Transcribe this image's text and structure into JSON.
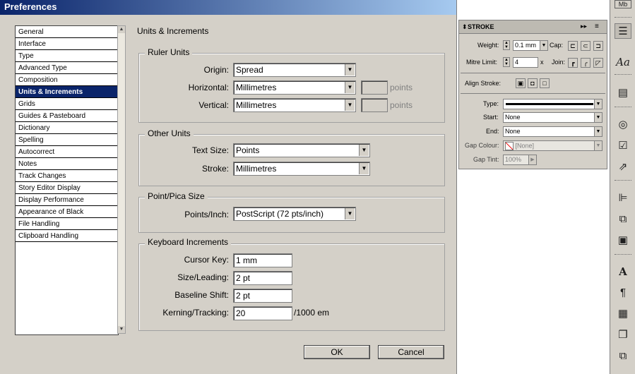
{
  "dialog": {
    "title": "Preferences",
    "categories": [
      "General",
      "Interface",
      "Type",
      "Advanced Type",
      "Composition",
      "Units & Increments",
      "Grids",
      "Guides & Pasteboard",
      "Dictionary",
      "Spelling",
      "Autocorrect",
      "Notes",
      "Track Changes",
      "Story Editor Display",
      "Display Performance",
      "Appearance of Black",
      "File Handling",
      "Clipboard Handling"
    ],
    "selected_category": "Units & Increments",
    "section_title": "Units & Increments",
    "ruler_units": {
      "title": "Ruler Units",
      "origin_label": "Origin:",
      "origin_value": "Spread",
      "horizontal_label": "Horizontal:",
      "horizontal_value": "Millimetres",
      "horizontal_points_label": "points",
      "vertical_label": "Vertical:",
      "vertical_value": "Millimetres",
      "vertical_points_label": "points"
    },
    "other_units": {
      "title": "Other Units",
      "text_size_label": "Text Size:",
      "text_size_value": "Points",
      "stroke_label": "Stroke:",
      "stroke_value": "Millimetres"
    },
    "point_pica": {
      "title": "Point/Pica Size",
      "points_inch_label": "Points/Inch:",
      "points_inch_value": "PostScript (72 pts/inch)"
    },
    "keyboard": {
      "title": "Keyboard Increments",
      "cursor_key_label": "Cursor Key:",
      "cursor_key_value": "1 mm",
      "size_leading_label": "Size/Leading:",
      "size_leading_value": "2 pt",
      "baseline_shift_label": "Baseline Shift:",
      "baseline_shift_value": "2 pt",
      "kerning_label": "Kerning/Tracking:",
      "kerning_value": "20",
      "kerning_unit": "/1000 em"
    },
    "ok_label": "OK",
    "cancel_label": "Cancel"
  },
  "stroke_panel": {
    "title": "STROKE",
    "weight_label": "Weight:",
    "weight_value": "0.1 mm",
    "cap_label": "Cap:",
    "mitre_label": "Mitre Limit:",
    "mitre_value": "4",
    "mitre_unit": "x",
    "join_label": "Join:",
    "align_label": "Align Stroke:",
    "type_label": "Type:",
    "start_label": "Start:",
    "start_value": "None",
    "end_label": "End:",
    "end_value": "None",
    "gap_colour_label": "Gap Colour:",
    "gap_colour_value": "[None]",
    "gap_tint_label": "Gap Tint:",
    "gap_tint_value": "100%"
  },
  "toolbar": {
    "top_badge": "Mb",
    "icons": [
      "stroke-icon",
      "character-icon",
      "pages-icon",
      "color-icon",
      "checkbox-icon",
      "transform-icon",
      "align-icon",
      "pathfinder-icon",
      "text-wrap-icon",
      "character-style-icon",
      "paragraph-style-icon",
      "table-icon",
      "layers-icon",
      "links-icon"
    ]
  },
  "colors": {
    "title_start": "#0a246a",
    "title_end": "#a6caf0",
    "panel_bg": "#d4d0c8",
    "selection": "#0a246a"
  }
}
